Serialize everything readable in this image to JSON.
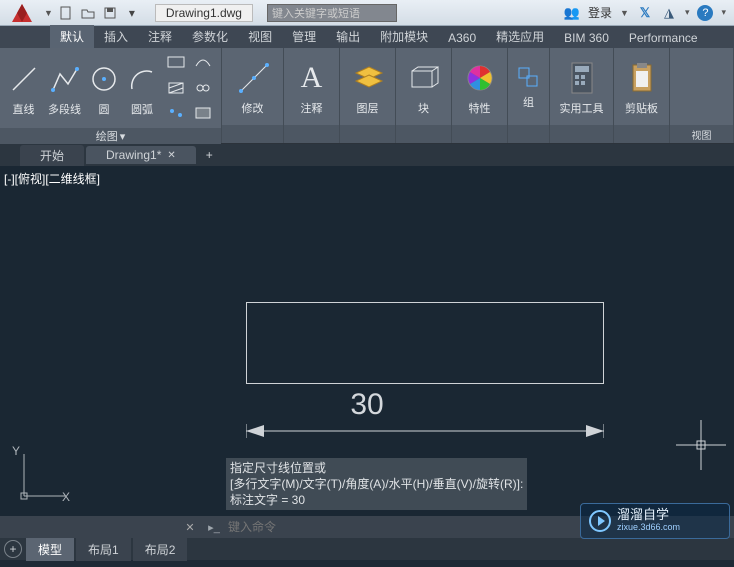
{
  "title": {
    "filename": "Drawing1.dwg"
  },
  "search": {
    "placeholder": "键入关键字或短语"
  },
  "login": {
    "label": "登录"
  },
  "menu_tabs": [
    "默认",
    "插入",
    "注释",
    "参数化",
    "视图",
    "管理",
    "输出",
    "附加模块",
    "A360",
    "精选应用",
    "BIM 360",
    "Performance"
  ],
  "active_menu_tab": 0,
  "ribbon": {
    "draw": {
      "title": "绘图",
      "line": "直线",
      "polyline": "多段线",
      "circle": "圆",
      "arc": "圆弧"
    },
    "modify": {
      "title": "修改"
    },
    "annotate": {
      "title": "注释"
    },
    "layer": {
      "title": "图层"
    },
    "block": {
      "title": "块"
    },
    "properties": {
      "title": "特性"
    },
    "group": {
      "title": "组"
    },
    "utilities": {
      "title": "实用工具"
    },
    "clipboard": {
      "title": "剪贴板"
    },
    "view": {
      "title": "视图"
    }
  },
  "doc_tabs": {
    "start": "开始",
    "drawing": "Drawing1*"
  },
  "viewport": {
    "label": "[-][俯视][二维线框]"
  },
  "dimension": {
    "value": "30"
  },
  "ucs": {
    "x": "X",
    "y": "Y"
  },
  "cmd_tip": {
    "line1": "指定尺寸线位置或",
    "line2": "[多行文字(M)/文字(T)/角度(A)/水平(H)/垂直(V)/旋转(R)]:",
    "line3": "标注文字 = 30"
  },
  "cmdline": {
    "placeholder": "键入命令"
  },
  "bottom_tabs": {
    "model": "模型",
    "layout1": "布局1",
    "layout2": "布局2"
  },
  "watermark": {
    "brand": "溜溜自学",
    "url": "zixue.3d66.com"
  }
}
